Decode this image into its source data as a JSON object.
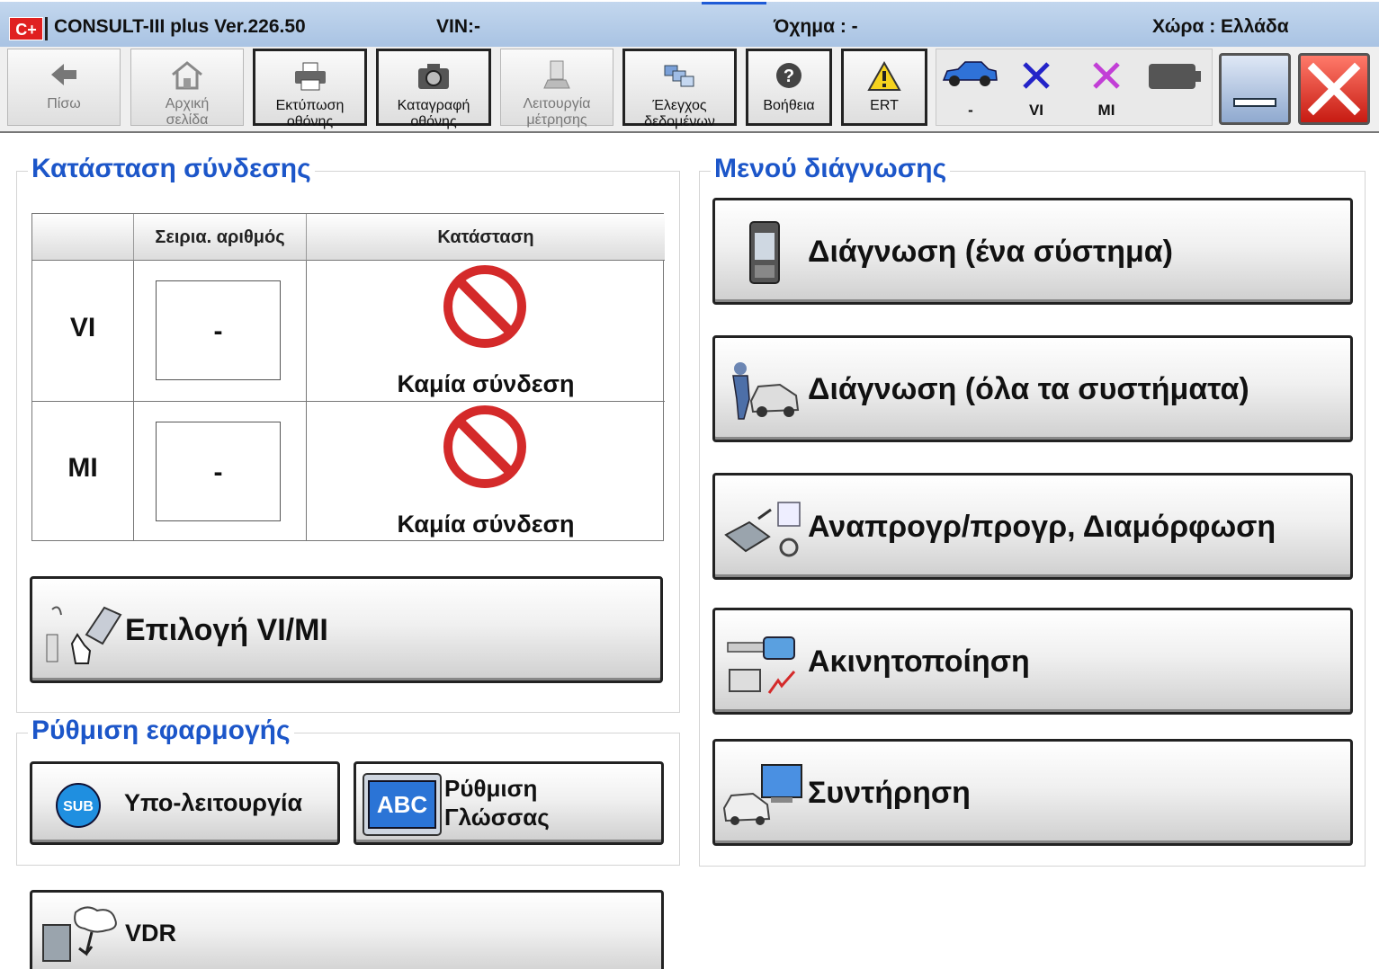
{
  "titlebar": {
    "logo": "C+",
    "app": "CONSULT-III plus  Ver.226.50",
    "vin": "VIN:-",
    "vehicle": "Όχημα : -",
    "country": "Χώρα : Ελλάδα"
  },
  "toolbar": {
    "back": "Πίσω",
    "home": [
      "Αρχική",
      "σελίδα"
    ],
    "print": [
      "Εκτύπωση",
      "οθόνης"
    ],
    "capture": [
      "Καταγραφή",
      "οθόνης"
    ],
    "measure": [
      "Λειτουργία",
      "μέτρησης"
    ],
    "datacheck": [
      "Έλεγχος",
      "δεδομένων"
    ],
    "help": "Βοήθεια",
    "ert": "ERT",
    "status_vehicle": "-",
    "status_vi": "VI",
    "status_mi": "MI"
  },
  "connection": {
    "title": "Κατάσταση σύνδεσης",
    "col_serial": "Σειρια. αριθμός",
    "col_status": "Κατάσταση",
    "rows": [
      {
        "label": "VI",
        "serial": "-",
        "status": "Καμία σύνδεση"
      },
      {
        "label": "MI",
        "serial": "-",
        "status": "Καμία σύνδεση"
      }
    ],
    "select_button": "Επιλογή VI/MI"
  },
  "app_settings": {
    "title": "Ρύθμιση εφαρμογής",
    "sub_icon_text": "SUB",
    "sub_function": "Υπο-λειτουργία",
    "abc_icon_text": "ABC",
    "language": [
      "Ρύθμιση",
      "Γλώσσας"
    ]
  },
  "vdr": "VDR",
  "diagnosis_menu": {
    "title": "Μενού διάγνωσης",
    "items": [
      "Διάγνωση (ένα σύστημα)",
      "Διάγνωση (όλα τα συστήματα)",
      "Αναπρογρ/προγρ, Διαμόρφωση",
      "Ακινητοποίηση",
      "Συντήρηση"
    ]
  },
  "colors": {
    "accent": "#1c56c9",
    "titlebar": "#b3cbe8",
    "no_conn": "#d42a2a",
    "vi_x": "#2323c8",
    "mi_x": "#c23fd6"
  }
}
